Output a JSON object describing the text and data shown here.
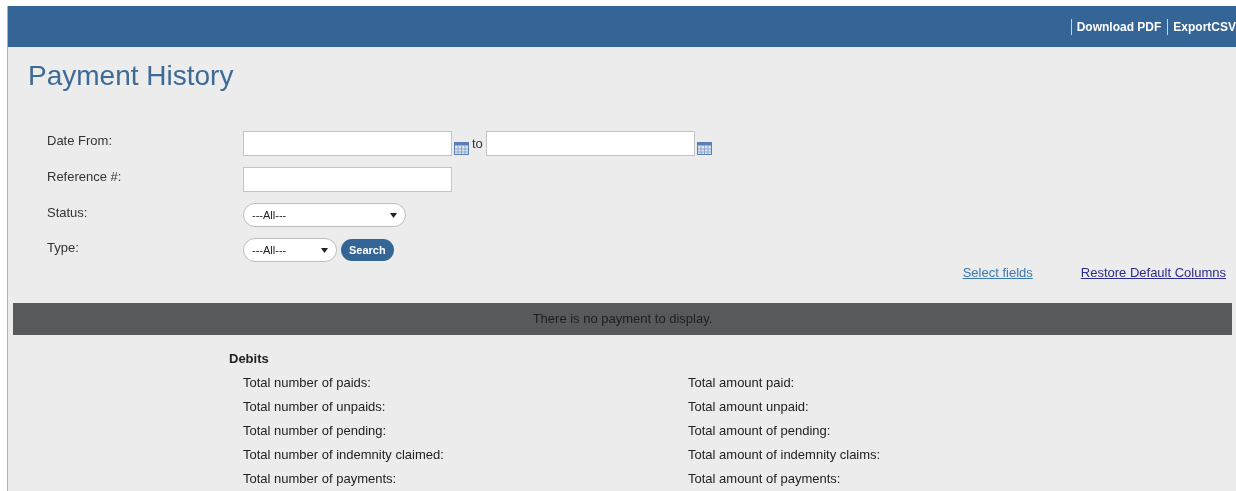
{
  "header": {
    "links": [
      "Download PDF",
      "ExportCSV"
    ]
  },
  "title": "Payment History",
  "filters": [
    {
      "kind": "daterange",
      "label": "Date From:",
      "separator": "to"
    },
    {
      "kind": "text",
      "label": "Reference #:"
    },
    {
      "kind": "select",
      "label": "Status:",
      "value": "---All---"
    },
    {
      "kind": "select_button",
      "label": "Type:",
      "value": "---All---",
      "button": "Search"
    }
  ],
  "links": [
    "Select fields",
    "Restore Default Columns"
  ],
  "empty_message": "There is no payment to display.",
  "summary": {
    "heading": "Debits",
    "left": [
      "Total number of paids:",
      "Total number of unpaids:",
      "Total number of pending:",
      "Total number of indemnity claimed:",
      "Total number of payments:"
    ],
    "right": [
      "Total amount paid:",
      "Total amount unpaid:",
      "Total amount of pending:",
      "Total amount of indemnity claims:",
      "Total amount of payments:"
    ]
  }
}
